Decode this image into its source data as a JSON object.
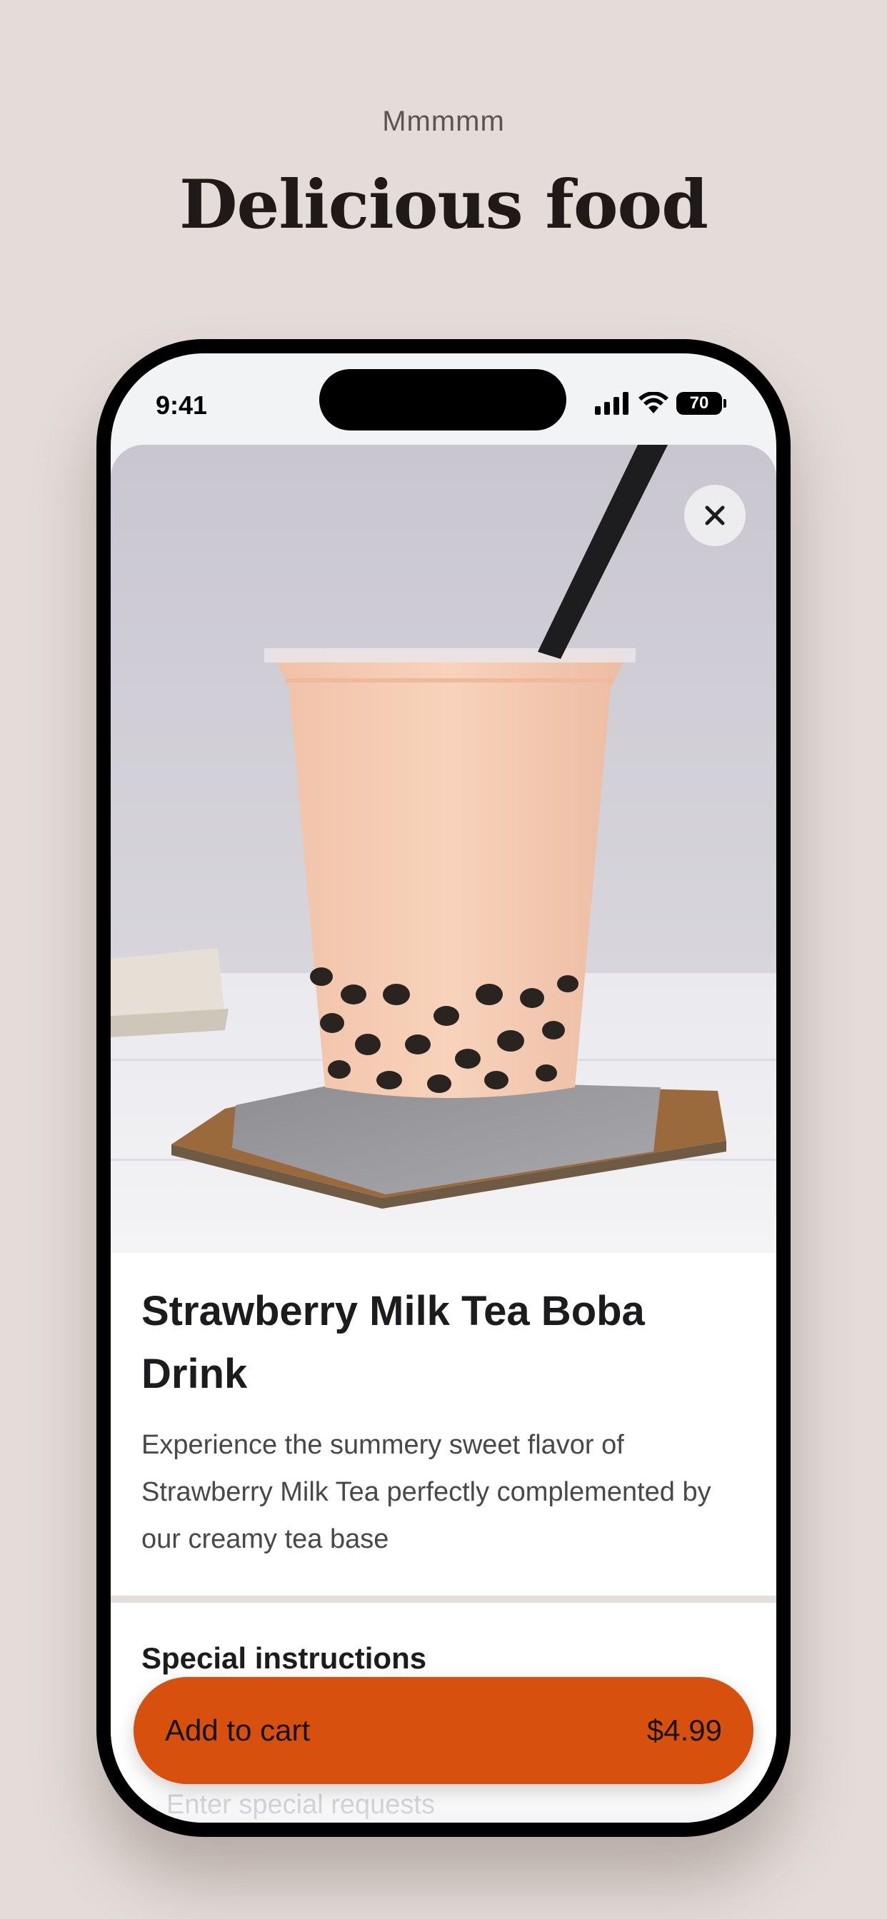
{
  "page": {
    "eyebrow": "Mmmmm",
    "headline": "Delicious food"
  },
  "status_bar": {
    "time": "9:41",
    "battery": "70"
  },
  "product": {
    "title": "Strawberry Milk Tea Boba Drink",
    "description": "Experience the summery sweet flavor of Strawberry Milk Tea perfectly complemented by our creamy tea base",
    "image_icon": "boba-drink-photo"
  },
  "special_instructions": {
    "label": "Special instructions",
    "placeholder": "Enter special requests"
  },
  "cta": {
    "label": "Add to cart",
    "price": "$4.99"
  },
  "colors": {
    "background": "#e4dcd9",
    "accent": "#d8500e",
    "heading": "#1f1a17"
  }
}
